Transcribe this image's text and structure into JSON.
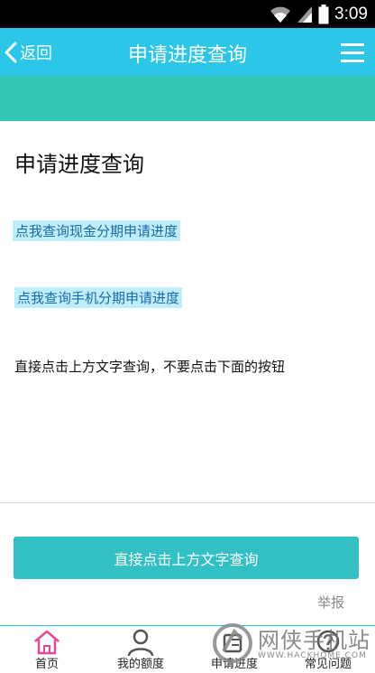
{
  "status_bar": {
    "time": "3:09",
    "icons": [
      "wifi-icon",
      "signal-icon",
      "battery-icon"
    ]
  },
  "nav": {
    "back_label": "返回",
    "title": "申请进度查询",
    "menu_icon": "hamburger-menu-icon"
  },
  "content": {
    "title": "申请进度查询",
    "link_cash": "点我查询现金分期申请进度",
    "link_phone": "点我查询手机分期申请进度",
    "instruction": "直接点击上方文字查询，不要点击下面的按钮"
  },
  "actions": {
    "main_button": "直接点击上方文字查询",
    "report": "举报"
  },
  "tabs": [
    {
      "label": "首页",
      "icon": "home-icon"
    },
    {
      "label": "我的额度",
      "icon": "user-icon"
    },
    {
      "label": "申请进度",
      "icon": "progress-icon"
    },
    {
      "label": "常见问题",
      "icon": "question-icon"
    }
  ],
  "watermark": {
    "text": "网侠手机站",
    "url": "WWW.HACKHOME.COM"
  },
  "colors": {
    "nav_bar": "#2cc6e9",
    "sub_band": "#34c7b6",
    "button": "#32c0c4",
    "link_highlight": "#bfeefb",
    "home_tab_accent": "#e8489a"
  }
}
